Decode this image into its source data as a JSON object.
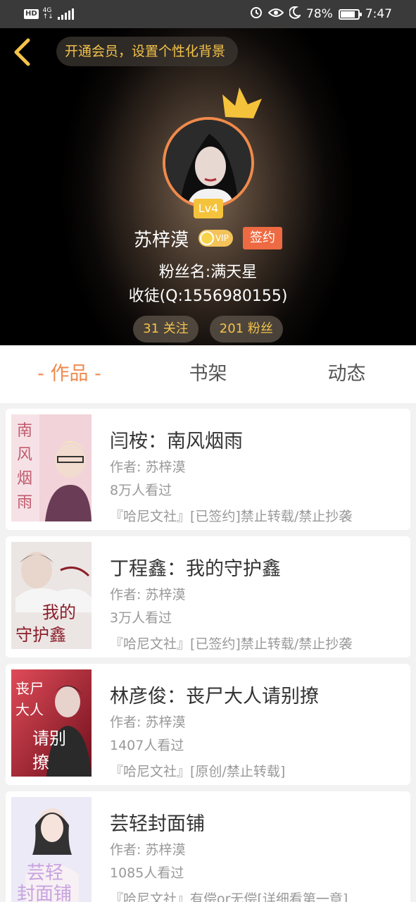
{
  "status_bar": {
    "hd": "HD",
    "network_top": "4G",
    "network_bottom": "↑↓",
    "battery_percent": "78%",
    "time": "7:47"
  },
  "header": {
    "member_prompt": "开通会员，设置个性化背景",
    "level": "Lv4",
    "name": "苏梓漠",
    "vip_label": "VIP",
    "sign_label": "签约",
    "fan_name": "粉丝名:满天星",
    "disciple": "收徒(Q:1556980155)",
    "follow_label": "31 关注",
    "fans_label": "201 粉丝"
  },
  "tabs": [
    {
      "label": "- 作品 -",
      "active": true
    },
    {
      "label": "书架",
      "active": false
    },
    {
      "label": "动态",
      "active": false
    }
  ],
  "works": [
    {
      "title": "闫桉：南风烟雨",
      "author": "作者: 苏梓漠",
      "views": "8万人看过",
      "tags": "『哈尼文社』[已签约]禁止转载/禁止抄袭",
      "cover_text": "南风烟雨",
      "cover_color": "#f3d6dc"
    },
    {
      "title": "丁程鑫：我的守护鑫",
      "author": "作者: 苏梓漠",
      "views": "3万人看过",
      "tags": "『哈尼文社』[已签约]禁止转载/禁止抄袭",
      "cover_text": "我的守护鑫",
      "cover_color": "#e9e4e2"
    },
    {
      "title": "林彦俊：丧尸大人请别撩",
      "author": "作者: 苏梓漠",
      "views": "1407人看过",
      "tags": "『哈尼文社』[原创/禁止转载]",
      "cover_text": "丧尸大人请别撩",
      "cover_color": "#c7283a"
    },
    {
      "title": "芸轻封面铺",
      "author": "作者: 苏梓漠",
      "views": "1085人看过",
      "tags": "『哈尼文社』有偿or无偿[详细看第一章]",
      "cover_text": "芸轻封面铺",
      "cover_color": "#e8eaf6"
    }
  ],
  "colors": {
    "accent": "#f08a4b",
    "gold": "#f3c34a",
    "sign": "#ee6a42"
  }
}
